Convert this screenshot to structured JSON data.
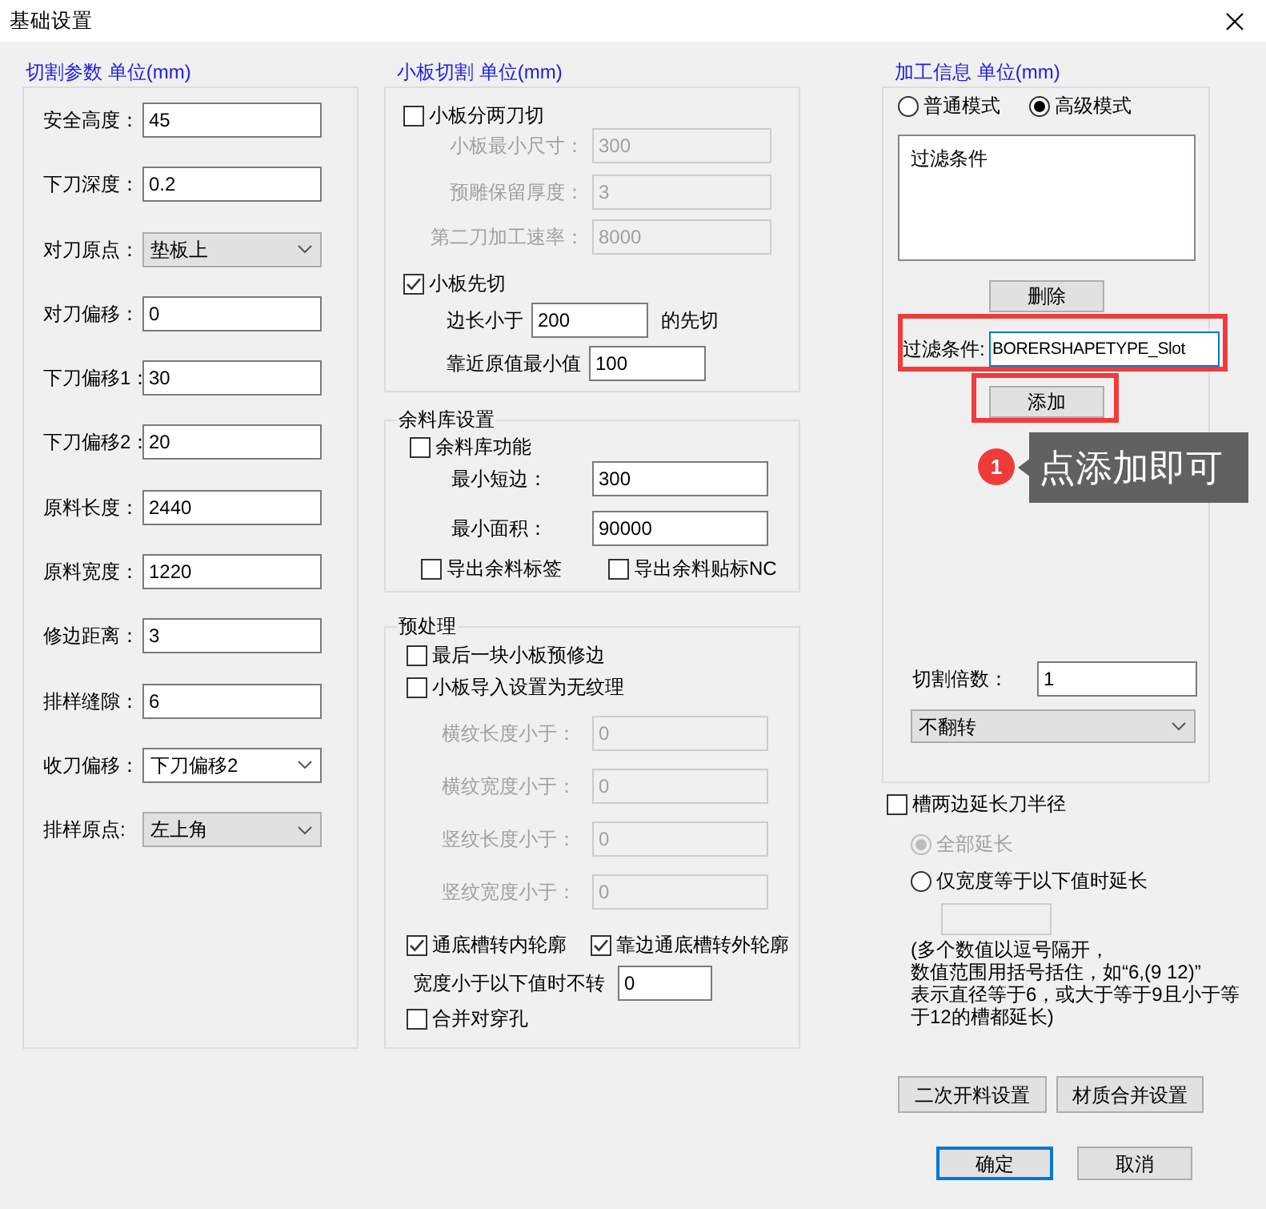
{
  "window": {
    "title": "基础设置"
  },
  "cutting": {
    "title": "切割参数 单位(mm)",
    "fields": [
      {
        "label": "安全高度：",
        "kind": "text",
        "value": "45"
      },
      {
        "label": "下刀深度：",
        "kind": "text",
        "value": "0.2"
      },
      {
        "label": "对刀原点：",
        "kind": "select",
        "value": "垫板上"
      },
      {
        "label": "对刀偏移：",
        "kind": "text",
        "value": "0"
      },
      {
        "label": "下刀偏移1：",
        "kind": "text",
        "value": "30"
      },
      {
        "label": "下刀偏移2：",
        "kind": "text",
        "value": "20"
      },
      {
        "label": "原料长度：",
        "kind": "text",
        "value": "2440"
      },
      {
        "label": "原料宽度：",
        "kind": "text",
        "value": "1220"
      },
      {
        "label": "修边距离：",
        "kind": "text",
        "value": "3"
      },
      {
        "label": "排样缝隙：",
        "kind": "text",
        "value": "6"
      },
      {
        "label": "收刀偏移：",
        "kind": "combo",
        "value": "下刀偏移2"
      },
      {
        "label": "排样原点:",
        "kind": "select",
        "value": "左上角"
      }
    ]
  },
  "small_board": {
    "title": "小板切割 单位(mm)",
    "split": {
      "label": "小板分两刀切",
      "checked": false
    },
    "split_fields": [
      {
        "label": "小板最小尺寸：",
        "value": "300",
        "disabled": true
      },
      {
        "label": "预雕保留厚度：",
        "value": "3",
        "disabled": true
      },
      {
        "label": "第二刀加工速率：",
        "value": "8000",
        "disabled": true
      }
    ],
    "cut_first": {
      "label": "小板先切",
      "checked": true
    },
    "edge": {
      "label": "边长小于",
      "value": "200",
      "suffix": "的先切"
    },
    "nearest": {
      "label": "靠近原值最小值",
      "value": "100"
    }
  },
  "remnant": {
    "title": "余料库设置",
    "enable": {
      "label": "余料库功能",
      "checked": false
    },
    "fields": [
      {
        "label": "最小短边：",
        "value": "300"
      },
      {
        "label": "最小面积：",
        "value": "90000"
      }
    ],
    "exports": [
      {
        "label": "导出余料标签",
        "checked": false
      },
      {
        "label": "导出余料贴标NC",
        "checked": false
      }
    ]
  },
  "preprocess": {
    "title": "预处理",
    "options": [
      {
        "label": "最后一块小板预修边",
        "checked": false
      },
      {
        "label": "小板导入设置为无纹理",
        "checked": false
      }
    ],
    "grain_fields": [
      {
        "label": "横纹长度小于：",
        "value": "0",
        "disabled": true
      },
      {
        "label": "横纹宽度小于：",
        "value": "0",
        "disabled": true
      },
      {
        "label": "竖纹长度小于：",
        "value": "0",
        "disabled": true
      },
      {
        "label": "竖纹宽度小于：",
        "value": "0",
        "disabled": true
      }
    ],
    "slot_options": [
      {
        "label": "通底槽转内轮廓",
        "checked": true
      },
      {
        "label": "靠边通底槽转外轮廓",
        "checked": true
      }
    ],
    "min_width": {
      "label": "宽度小于以下值时不转",
      "value": "0"
    },
    "merge_holes": {
      "label": "合并对穿孔",
      "checked": false
    }
  },
  "processing": {
    "title": "加工信息 单位(mm)",
    "modes": [
      {
        "label": "普通模式",
        "selected": false
      },
      {
        "label": "高级模式",
        "selected": true
      }
    ],
    "filter_list": [
      "过滤条件"
    ],
    "delete_button": "删除",
    "filter": {
      "label": "过滤条件:",
      "value": "BORERSHAPETYPE_Slot",
      "highlighted": true
    },
    "add_button": {
      "label": "添加",
      "highlighted": true
    },
    "multiplier": {
      "label": "切割倍数：",
      "value": "1"
    },
    "flip": {
      "value": "不翻转"
    }
  },
  "slot_extend": {
    "label": "槽两边延长刀半径",
    "checked": false,
    "modes": [
      {
        "label": "全部延长",
        "selected": true,
        "disabled": true
      },
      {
        "label": "仅宽度等于以下值时延长",
        "selected": false,
        "disabled": false
      }
    ],
    "width_field": {
      "disabled": true
    },
    "note_lines": [
      "(多个数值以逗号隔开，",
      "数值范围用括号括住，如“6,(9 12)”",
      "表示直径等于6，或大于等于9且小于等",
      "于12的槽都延长)"
    ]
  },
  "setup_buttons": [
    "二次开料设置",
    "材质合并设置"
  ],
  "dialog_buttons": [
    {
      "label": "确定",
      "default": true
    },
    {
      "label": "取消",
      "default": false
    }
  ],
  "callout": {
    "marker": "1",
    "text": "点添加即可"
  }
}
